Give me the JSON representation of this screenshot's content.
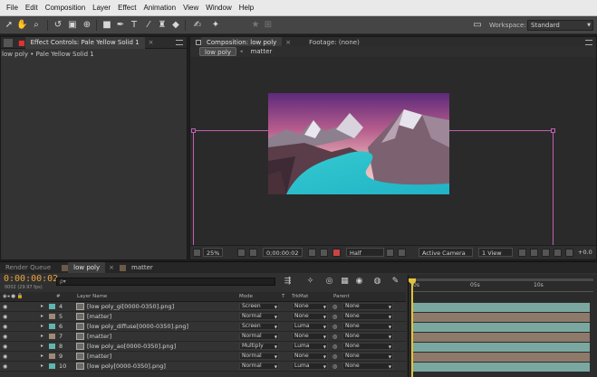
{
  "menu": [
    "File",
    "Edit",
    "Composition",
    "Layer",
    "Effect",
    "Animation",
    "View",
    "Window",
    "Help"
  ],
  "toolbar": {
    "icons": [
      "selection-tool-icon",
      "hand-tool-icon",
      "zoom-tool-icon",
      "rotate-tool-icon",
      "camera-tool-icon",
      "pan-behind-tool-icon",
      "pen-tool-icon",
      "type-tool-icon",
      "brush-tool-icon",
      "clone-stamp-tool-icon",
      "eraser-tool-icon",
      "roto-brush-tool-icon",
      "puppet-tool-icon"
    ],
    "workspace_label": "Workspace:",
    "workspace_value": "Standard"
  },
  "left_panel": {
    "tab": "Effect Controls: Pale Yellow Solid 1",
    "subtitle": "low poly • Pale Yellow Solid 1"
  },
  "comp_panel": {
    "tab_comp": "Composition: low poly",
    "tab_footage": "Footage: (none)",
    "crumbs": [
      "low poly",
      "matter"
    ],
    "bottom": {
      "zoom": "25%",
      "timecode": "0;00:00:02",
      "resolution": "Half",
      "camera": "Active Camera",
      "views": "1 View",
      "exposure": "+0.0"
    }
  },
  "timeline": {
    "tabs": [
      "Render Queue",
      "low poly",
      "matter"
    ],
    "timecode": "0:00:00:02",
    "frames": "0002 (29.97 fps)",
    "search_placeholder": "ρ▾",
    "columns": {
      "num": "#",
      "layer": "Layer Name",
      "mode": "Mode",
      "t": "T",
      "trkmat": "TrkMat",
      "parent": "Parent"
    },
    "ruler": [
      "0s",
      "05s",
      "10s"
    ],
    "layers": [
      {
        "num": "4",
        "name": "[low poly_gi[0000-0350].png]",
        "mode": "Screen",
        "trkmat": "None",
        "parent": "None",
        "label": "#5fb6b0"
      },
      {
        "num": "5",
        "name": "[matter]",
        "mode": "Normal",
        "trkmat": "None",
        "parent": "None",
        "label": "#9e8a78"
      },
      {
        "num": "6",
        "name": "[low poly_diffuse[0000-0350].png]",
        "mode": "Screen",
        "trkmat": "Luma",
        "parent": "None",
        "label": "#5fb6b0"
      },
      {
        "num": "7",
        "name": "[matter]",
        "mode": "Normal",
        "trkmat": "None",
        "parent": "None",
        "label": "#9e8a78"
      },
      {
        "num": "8",
        "name": "[low poly_ao[0000-0350].png]",
        "mode": "Multiply",
        "trkmat": "Luma",
        "parent": "None",
        "label": "#5fb6b0"
      },
      {
        "num": "9",
        "name": "[matter]",
        "mode": "Normal",
        "trkmat": "None",
        "parent": "None",
        "label": "#9e8a78"
      },
      {
        "num": "10",
        "name": "[low poly[0000-0350].png]",
        "mode": "Normal",
        "trkmat": "Luma",
        "parent": "None",
        "label": "#5fb6b0"
      }
    ]
  },
  "colors": {
    "accent": "#e8a43a",
    "comp_border": "#c35fb0",
    "bar_teal": "#7aa8a0",
    "bar_brown": "#8d7a6a"
  }
}
